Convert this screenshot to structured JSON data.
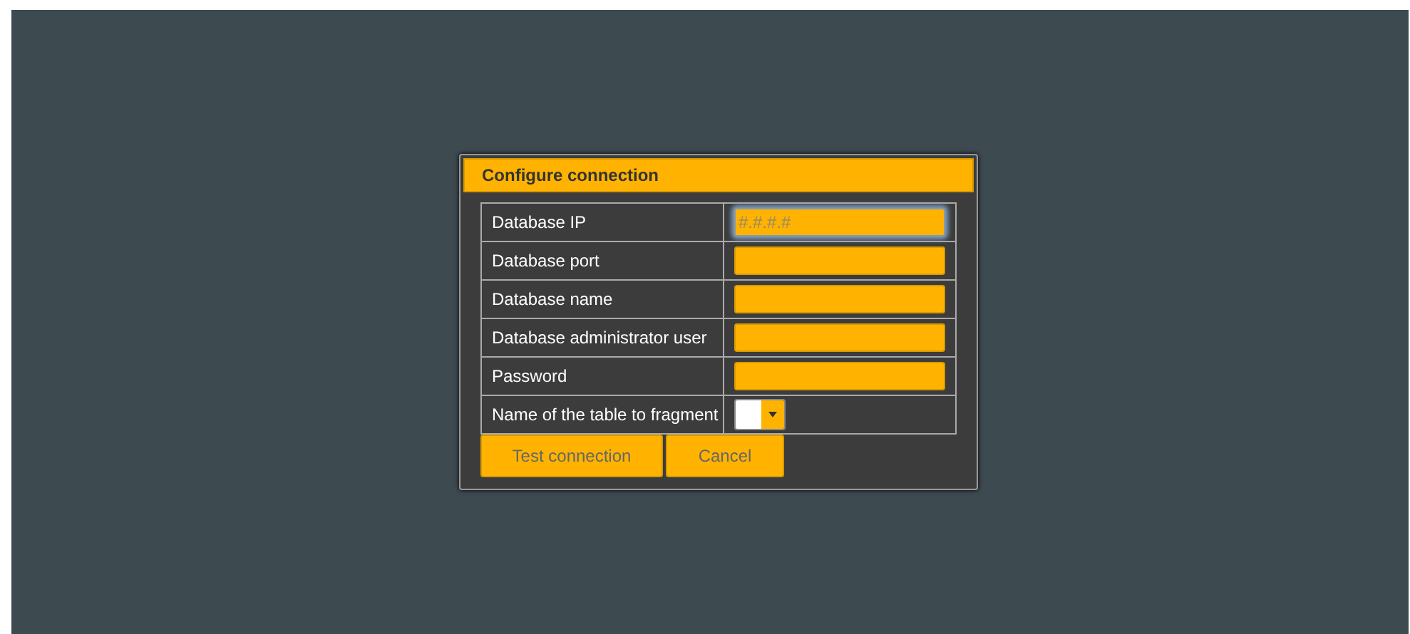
{
  "dialog": {
    "title": "Configure connection",
    "fields": [
      {
        "label": "Database IP",
        "kind": "text",
        "placeholder": "#.#.#.#",
        "focused": true
      },
      {
        "label": "Database port",
        "kind": "text",
        "focused": false
      },
      {
        "label": "Database name",
        "kind": "text",
        "focused": false
      },
      {
        "label": "Database administrator user",
        "kind": "text",
        "focused": false
      },
      {
        "label": "Password",
        "kind": "password",
        "focused": false
      },
      {
        "label": "Name of the table to fragment",
        "kind": "select",
        "focused": false
      }
    ],
    "buttons": [
      "Test connection",
      "Cancel"
    ]
  }
}
